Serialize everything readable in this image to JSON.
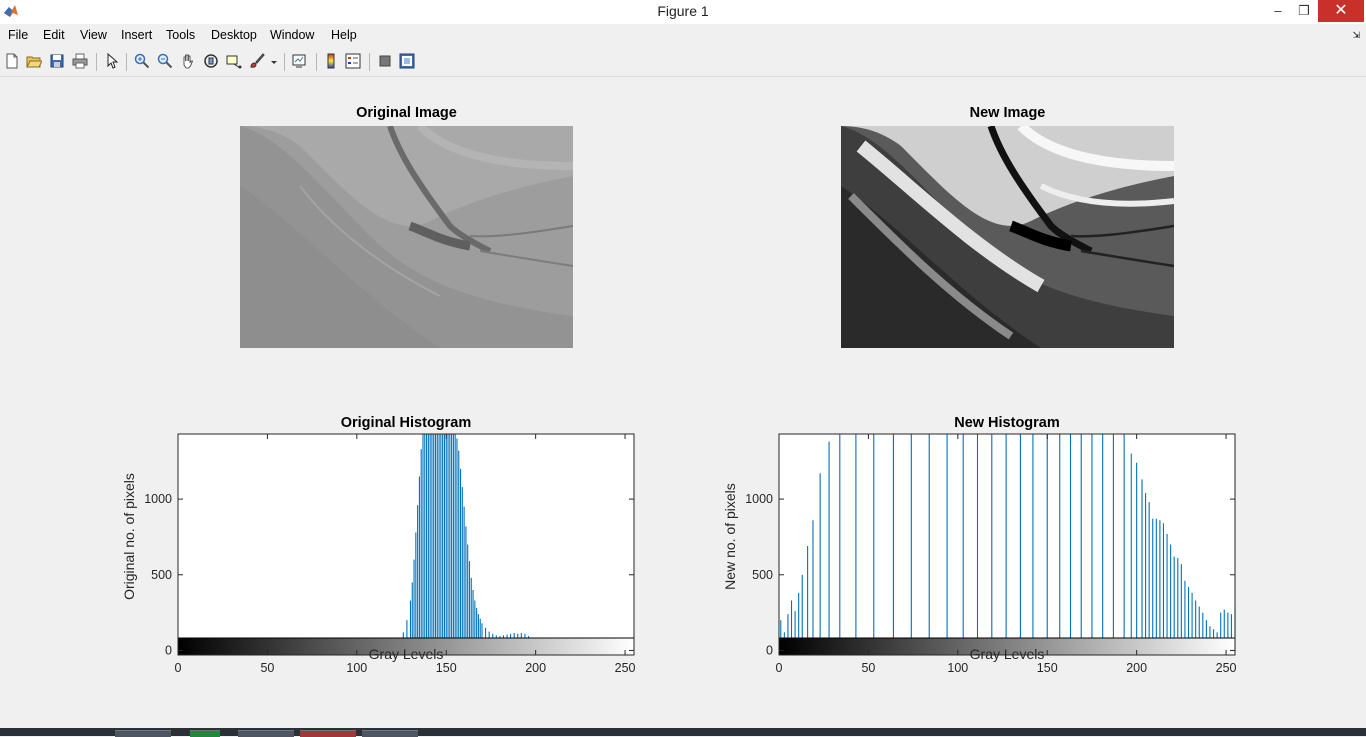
{
  "window": {
    "title": "Figure 1",
    "minimize": "–",
    "restore": "❐",
    "close": "✕"
  },
  "menu": {
    "items": [
      "File",
      "Edit",
      "View",
      "Insert",
      "Tools",
      "Desktop",
      "Window",
      "Help"
    ],
    "overflow": "⇲"
  },
  "toolbar": {
    "icons": [
      "new-figure-icon",
      "open-file-icon",
      "save-icon",
      "print-icon",
      "edit-plot-icon",
      "zoom-in-icon",
      "zoom-out-icon",
      "pan-icon",
      "rotate-3d-icon",
      "data-cursor-icon",
      "brush-icon",
      "brush-dropdown-icon",
      "link-plot-icon",
      "colorbar-icon",
      "legend-icon",
      "hide-plot-tools-icon",
      "show-plot-tools-icon"
    ]
  },
  "panels": {
    "original_image": {
      "title": "Original Image"
    },
    "new_image": {
      "title": "New Image"
    }
  },
  "chart_data": [
    {
      "type": "bar",
      "title": "Original Histogram",
      "xlabel": "Gray Levels",
      "ylabel": "Original no. of pixels",
      "xlim": [
        0,
        255
      ],
      "ylim": [
        -30,
        1430
      ],
      "xticks": [
        "0",
        "50",
        "100",
        "150",
        "200",
        "250"
      ],
      "yticks": [
        "0",
        "500",
        "1000"
      ],
      "colorbar": true,
      "x": [
        116,
        118,
        120,
        122,
        124,
        126,
        128,
        130,
        131,
        132,
        133,
        134,
        135,
        136,
        137,
        138,
        139,
        140,
        141,
        142,
        143,
        144,
        145,
        146,
        147,
        148,
        149,
        150,
        151,
        152,
        153,
        154,
        155,
        156,
        157,
        158,
        159,
        160,
        161,
        162,
        163,
        164,
        165,
        166,
        167,
        168,
        169,
        170,
        172,
        174,
        176,
        178,
        180,
        182,
        184,
        186,
        188,
        190,
        192,
        194,
        196,
        198,
        200,
        202,
        204,
        206,
        208
      ],
      "values": [
        5,
        10,
        20,
        40,
        70,
        120,
        200,
        330,
        450,
        600,
        780,
        960,
        1150,
        1330,
        1430,
        1430,
        1430,
        1430,
        1430,
        1430,
        1430,
        1430,
        1430,
        1430,
        1430,
        1430,
        1430,
        1430,
        1430,
        1430,
        1430,
        1430,
        1430,
        1400,
        1320,
        1200,
        1080,
        950,
        820,
        700,
        590,
        480,
        400,
        330,
        280,
        240,
        210,
        180,
        150,
        125,
        110,
        100,
        95,
        100,
        105,
        110,
        115,
        110,
        115,
        110,
        95,
        80,
        60,
        40,
        25,
        10,
        5
      ]
    },
    {
      "type": "bar",
      "title": "New Histogram",
      "xlabel": "Gray Levels",
      "ylabel": "New no. of pixels",
      "xlim": [
        0,
        255
      ],
      "ylim": [
        -30,
        1430
      ],
      "xticks": [
        "0",
        "50",
        "100",
        "150",
        "200",
        "250"
      ],
      "yticks": [
        "0",
        "500",
        "1000"
      ],
      "colorbar": true,
      "x": [
        1,
        3,
        5,
        7,
        9,
        11,
        13,
        16,
        19,
        23,
        28,
        34,
        43,
        53,
        64,
        74,
        84,
        94,
        103,
        111,
        119,
        127,
        135,
        142,
        150,
        157,
        163,
        169,
        175,
        181,
        187,
        193,
        197,
        200,
        203,
        205,
        207,
        209,
        211,
        213,
        215,
        217,
        219,
        221,
        223,
        225,
        227,
        229,
        231,
        233,
        235,
        237,
        239,
        241,
        243,
        245,
        247,
        249,
        251,
        253,
        255
      ],
      "values": [
        200,
        120,
        240,
        330,
        260,
        380,
        500,
        690,
        860,
        1170,
        1380,
        1430,
        1430,
        1430,
        1430,
        1430,
        1430,
        1430,
        1430,
        1430,
        1430,
        1430,
        1430,
        1430,
        1430,
        1430,
        1430,
        1430,
        1430,
        1430,
        1430,
        1430,
        1300,
        1240,
        1130,
        1040,
        980,
        870,
        870,
        860,
        840,
        770,
        700,
        620,
        610,
        570,
        460,
        420,
        380,
        330,
        290,
        250,
        200,
        160,
        140,
        120,
        250,
        270,
        250,
        240,
        290
      ]
    }
  ]
}
